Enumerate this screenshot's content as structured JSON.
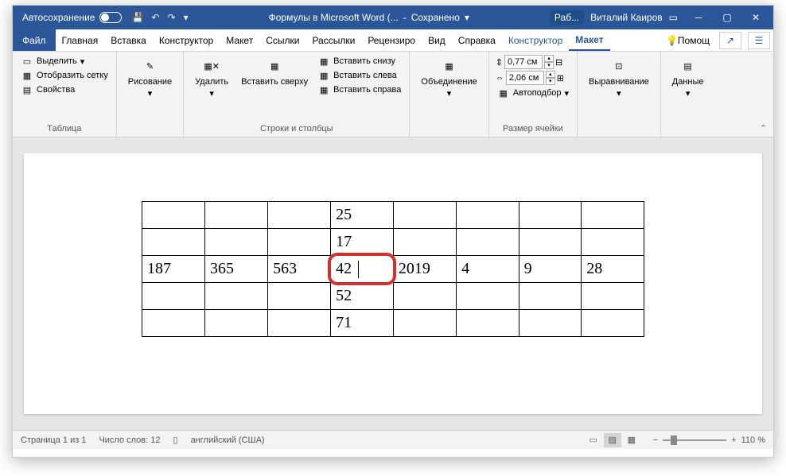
{
  "titlebar": {
    "autosave": "Автосохранение",
    "doc_title": "Формулы в Microsoft Word (...",
    "saved_status": "Сохранено",
    "badge": "Раб...",
    "user": "Виталий Каиров"
  },
  "menu": {
    "file": "Файл",
    "tabs": [
      "Главная",
      "Вставка",
      "Конструктор",
      "Макет",
      "Ссылки",
      "Рассылки",
      "Рецензиро",
      "Вид",
      "Справка"
    ],
    "context_tabs": [
      "Конструктор",
      "Макет"
    ],
    "help": "Помощ"
  },
  "ribbon": {
    "table_group": {
      "label": "Таблица",
      "select": "Выделить",
      "gridlines": "Отобразить сетку",
      "properties": "Свойства"
    },
    "draw_group": {
      "draw": "Рисование"
    },
    "delete": "Удалить",
    "insert_above": "Вставить сверху",
    "insert_below": "Вставить снизу",
    "insert_left": "Вставить слева",
    "insert_right": "Вставить справа",
    "rows_cols_label": "Строки и столбцы",
    "merge": "Объединение",
    "height": "0,77 см",
    "width": "2,06 см",
    "autofit": "Автоподбор",
    "cell_size_label": "Размер ячейки",
    "alignment": "Выравнивание",
    "data": "Данные"
  },
  "doc_table": {
    "rows": [
      [
        "",
        "",
        "",
        "25",
        "",
        "",
        "",
        ""
      ],
      [
        "",
        "",
        "",
        "17",
        "",
        "",
        "",
        ""
      ],
      [
        "187",
        "365",
        "563",
        "42",
        "2019",
        "4",
        "9",
        "28"
      ],
      [
        "",
        "",
        "",
        "52",
        "",
        "",
        "",
        ""
      ],
      [
        "",
        "",
        "",
        "71",
        "",
        "",
        "",
        ""
      ]
    ],
    "highlight_cell": [
      2,
      3
    ]
  },
  "statusbar": {
    "page": "Страница 1 из 1",
    "words": "Число слов: 12",
    "language": "английский (США)",
    "zoom": "110 %"
  }
}
